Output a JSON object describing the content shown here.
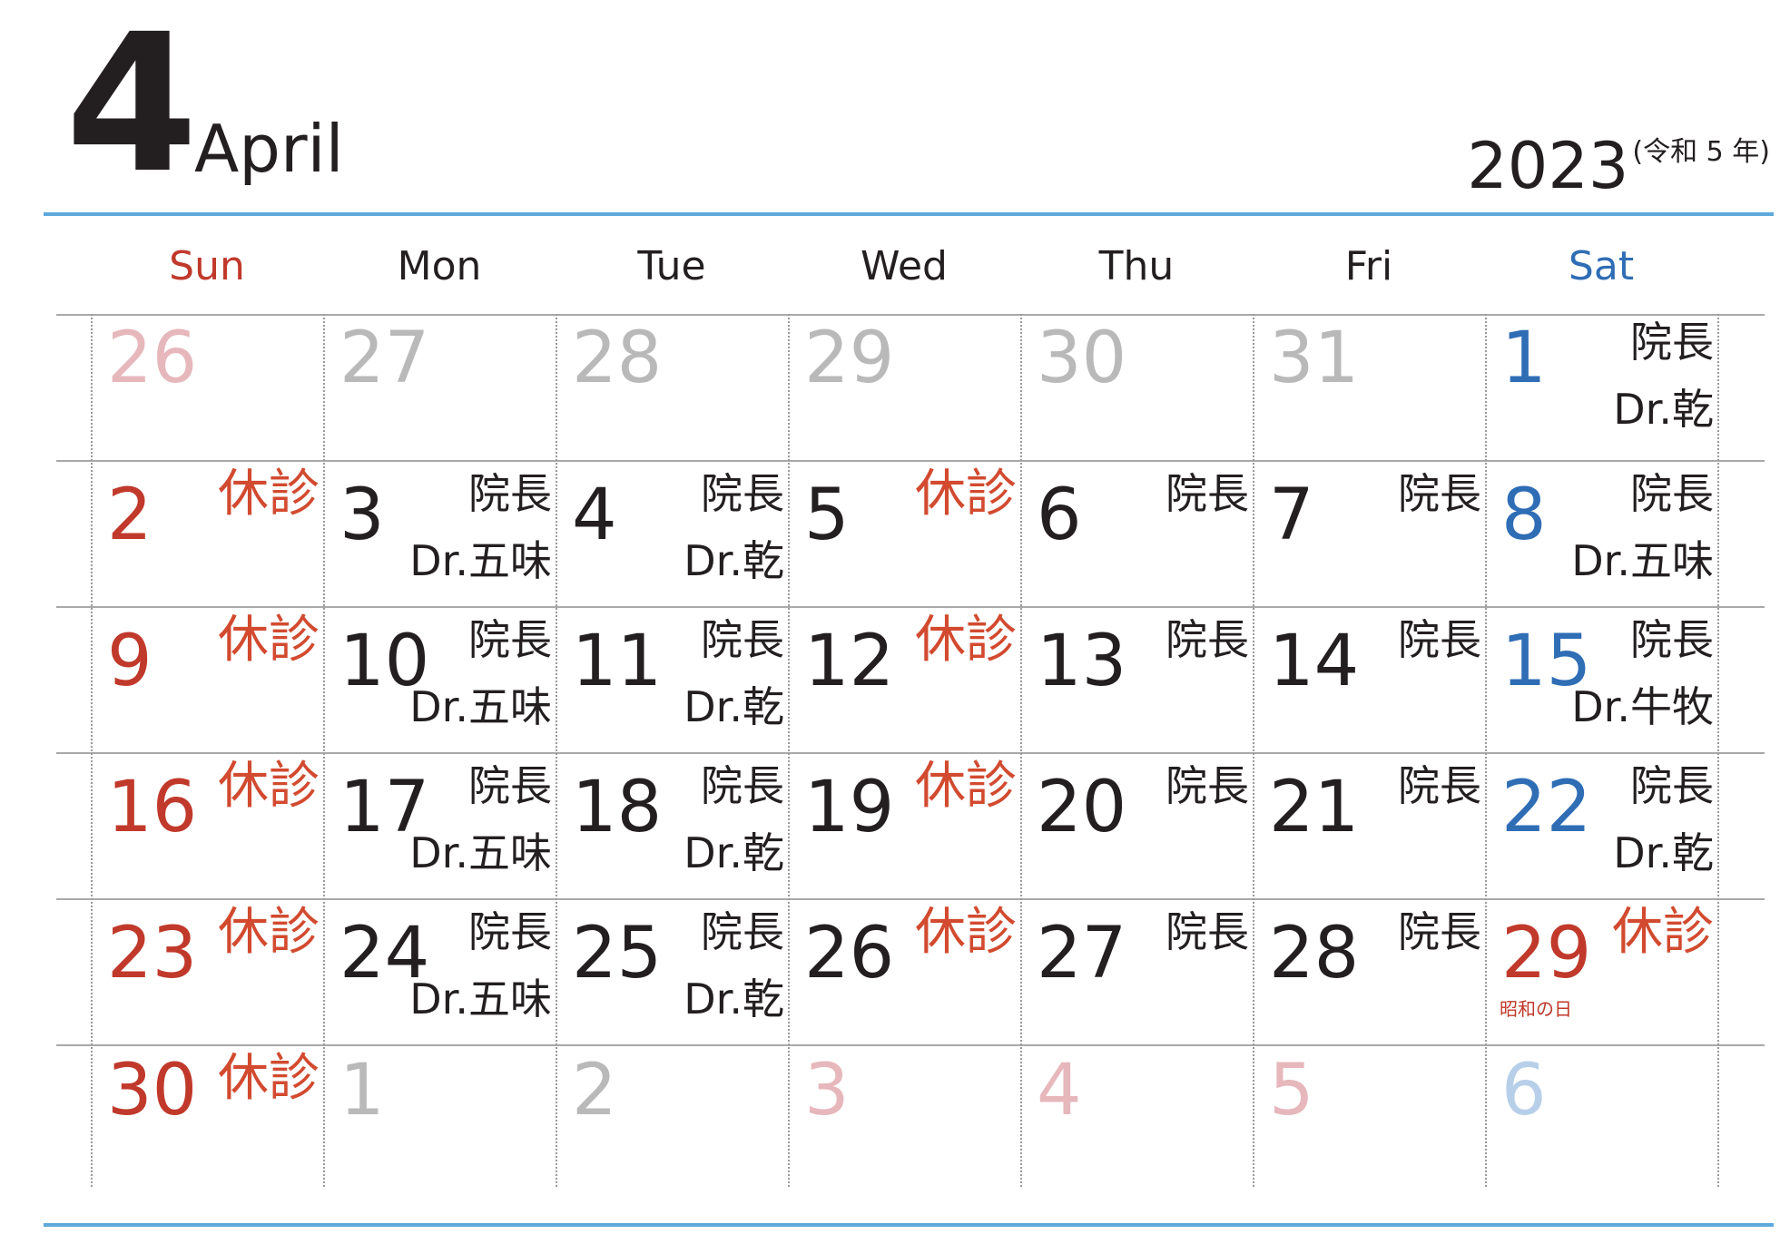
{
  "header": {
    "month_number": "4",
    "month_name": "April",
    "year": "2023",
    "era": "(令和 5 年)"
  },
  "weekdays": [
    "Sun",
    "Mon",
    "Tue",
    "Wed",
    "Thu",
    "Fri",
    "Sat"
  ],
  "colors": {
    "rule": "#5ea9dc",
    "sunday": "#c0392b",
    "saturday": "#2f6db5",
    "closed": "#d24a2f",
    "outside_month": "#b9b9b9"
  },
  "weeks": [
    [
      {
        "day": "26",
        "color": "pink",
        "line1": "",
        "line2": ""
      },
      {
        "day": "27",
        "color": "gray",
        "line1": "",
        "line2": ""
      },
      {
        "day": "28",
        "color": "gray",
        "line1": "",
        "line2": ""
      },
      {
        "day": "29",
        "color": "gray",
        "line1": "",
        "line2": ""
      },
      {
        "day": "30",
        "color": "gray",
        "line1": "",
        "line2": ""
      },
      {
        "day": "31",
        "color": "gray",
        "line1": "",
        "line2": ""
      },
      {
        "day": "1",
        "color": "blue",
        "line1": "院長",
        "line2": "Dr.乾"
      }
    ],
    [
      {
        "day": "2",
        "color": "red",
        "line1": "休診",
        "closed": true,
        "line2": ""
      },
      {
        "day": "3",
        "color": "dark",
        "line1": "院長",
        "line2": "Dr.五味"
      },
      {
        "day": "4",
        "color": "dark",
        "line1": "院長",
        "line2": "Dr.乾"
      },
      {
        "day": "5",
        "color": "dark",
        "line1": "休診",
        "closed": true,
        "line2": ""
      },
      {
        "day": "6",
        "color": "dark",
        "line1": "院長",
        "line2": ""
      },
      {
        "day": "7",
        "color": "dark",
        "line1": "院長",
        "line2": ""
      },
      {
        "day": "8",
        "color": "blue",
        "line1": "院長",
        "line2": "Dr.五味"
      }
    ],
    [
      {
        "day": "9",
        "color": "red",
        "line1": "休診",
        "closed": true,
        "line2": ""
      },
      {
        "day": "10",
        "color": "dark",
        "line1": "院長",
        "line2": "Dr.五味"
      },
      {
        "day": "11",
        "color": "dark",
        "line1": "院長",
        "line2": "Dr.乾"
      },
      {
        "day": "12",
        "color": "dark",
        "line1": "休診",
        "closed": true,
        "line2": ""
      },
      {
        "day": "13",
        "color": "dark",
        "line1": "院長",
        "line2": ""
      },
      {
        "day": "14",
        "color": "dark",
        "line1": "院長",
        "line2": ""
      },
      {
        "day": "15",
        "color": "blue",
        "line1": "院長",
        "line2": "Dr.牛牧"
      }
    ],
    [
      {
        "day": "16",
        "color": "red",
        "line1": "休診",
        "closed": true,
        "line2": ""
      },
      {
        "day": "17",
        "color": "dark",
        "line1": "院長",
        "line2": "Dr.五味"
      },
      {
        "day": "18",
        "color": "dark",
        "line1": "院長",
        "line2": "Dr.乾"
      },
      {
        "day": "19",
        "color": "dark",
        "line1": "休診",
        "closed": true,
        "line2": ""
      },
      {
        "day": "20",
        "color": "dark",
        "line1": "院長",
        "line2": ""
      },
      {
        "day": "21",
        "color": "dark",
        "line1": "院長",
        "line2": ""
      },
      {
        "day": "22",
        "color": "blue",
        "line1": "院長",
        "line2": "Dr.乾"
      }
    ],
    [
      {
        "day": "23",
        "color": "red",
        "line1": "休診",
        "closed": true,
        "line2": ""
      },
      {
        "day": "24",
        "color": "dark",
        "line1": "院長",
        "line2": "Dr.五味"
      },
      {
        "day": "25",
        "color": "dark",
        "line1": "院長",
        "line2": "Dr.乾"
      },
      {
        "day": "26",
        "color": "dark",
        "line1": "休診",
        "closed": true,
        "line2": ""
      },
      {
        "day": "27",
        "color": "dark",
        "line1": "院長",
        "line2": ""
      },
      {
        "day": "28",
        "color": "dark",
        "line1": "院長",
        "line2": ""
      },
      {
        "day": "29",
        "color": "red",
        "line1": "休診",
        "closed": true,
        "line2": "",
        "holiday": "昭和の日"
      }
    ],
    [
      {
        "day": "30",
        "color": "red",
        "line1": "休診",
        "closed": true,
        "line2": ""
      },
      {
        "day": "1",
        "color": "gray",
        "line1": "",
        "line2": ""
      },
      {
        "day": "2",
        "color": "gray",
        "line1": "",
        "line2": ""
      },
      {
        "day": "3",
        "color": "pink",
        "line1": "",
        "line2": ""
      },
      {
        "day": "4",
        "color": "pink",
        "line1": "",
        "line2": ""
      },
      {
        "day": "5",
        "color": "pink",
        "line1": "",
        "line2": ""
      },
      {
        "day": "6",
        "color": "lightblue",
        "line1": "",
        "line2": ""
      }
    ]
  ]
}
